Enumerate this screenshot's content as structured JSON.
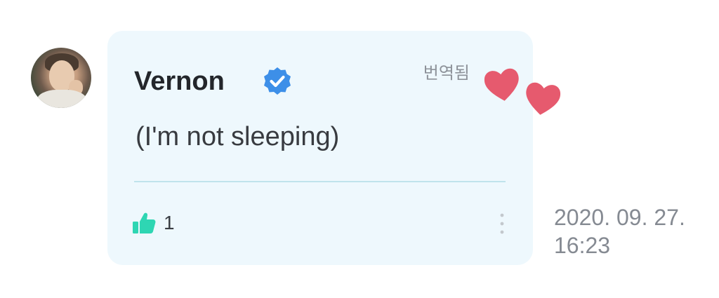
{
  "comment": {
    "author": "Vernon",
    "verified_icon": "verified-badge-icon",
    "translated_label": "번역됨",
    "message": "(I'm not sleeping)",
    "like_icon": "thumbs-up-icon",
    "like_count": "1",
    "more_icon": "vertical-dots-icon",
    "timestamp_date": "2020. 09. 27.",
    "timestamp_time": "16:23"
  },
  "decorations": {
    "hearts_icon": "hearts-icon"
  },
  "colors": {
    "card_background": "#eef8fd",
    "verified_blue": "#3d8fe8",
    "like_green": "#2ed6b3",
    "heart_red": "#e65a6e",
    "divider": "#bfe3ec"
  }
}
